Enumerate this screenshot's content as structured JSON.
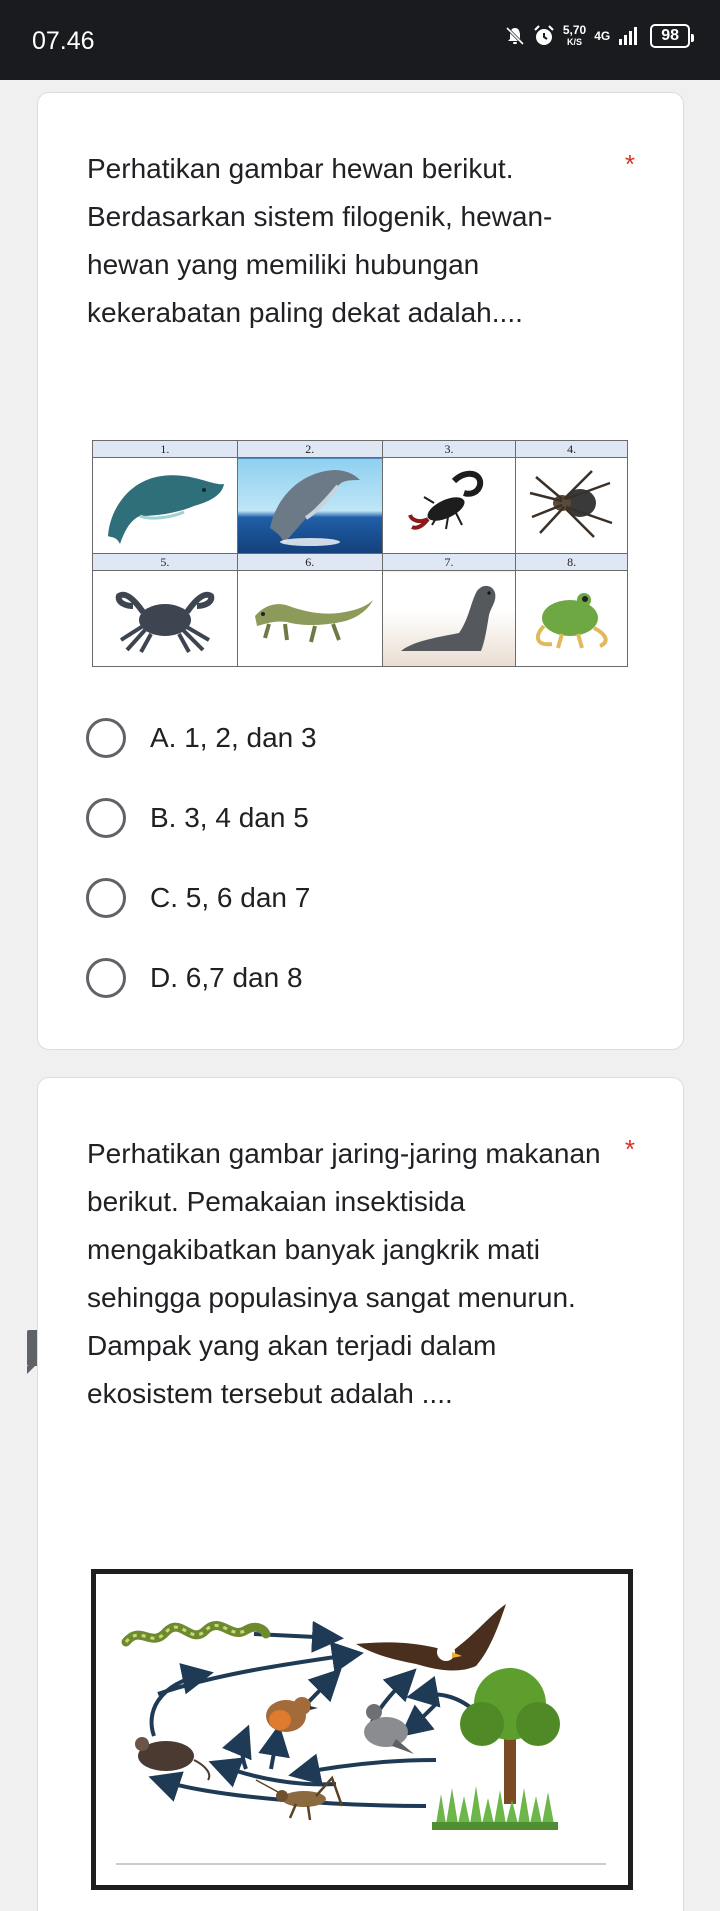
{
  "status_bar": {
    "time": "07.46",
    "speed_value": "5,70",
    "speed_unit": "K/S",
    "network": "4G",
    "battery": "98",
    "icons": [
      "mute-bell-icon",
      "alarm-icon",
      "signal-icon",
      "battery-icon"
    ]
  },
  "question1": {
    "title": "Perhatikan gambar hewan berikut. Berdasarkan sistem filogenik, hewan-hewan yang memiliki hubungan kekerabatan paling dekat adalah....",
    "required_mark": "*",
    "image_labels": [
      "1.",
      "2.",
      "3.",
      "4.",
      "5.",
      "6.",
      "7.",
      "8."
    ],
    "animals": [
      "whale",
      "dolphin",
      "scorpion",
      "spider",
      "crab",
      "iguana",
      "sea-lion",
      "frog"
    ],
    "options": [
      "A. 1, 2, dan 3",
      "B. 3, 4 dan 5",
      "C. 5, 6 dan 7",
      "D. 6,7 dan 8"
    ]
  },
  "question2": {
    "title": "Perhatikan gambar jaring-jaring makanan berikut. Pemakaian insektisida mengakibatkan banyak jangkrik mati sehingga populasinya sangat menurun. Dampak yang akan terjadi dalam ekosistem tersebut adalah ....",
    "required_mark": "*",
    "warning_mark": "!",
    "organisms": [
      "snake",
      "eagle",
      "mouse",
      "robin",
      "pigeon",
      "tree",
      "cricket",
      "grass"
    ]
  },
  "colors": {
    "status_bar_bg": "#1a1b1f",
    "page_bg": "#f0f0f0",
    "card_bg": "#ffffff",
    "required": "#d93025",
    "radio": "#5f6368",
    "arrow": "#1f3a55"
  }
}
